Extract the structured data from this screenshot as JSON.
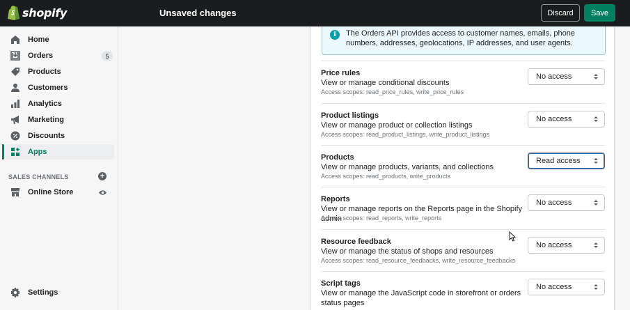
{
  "topbar": {
    "logo_text": "shopify",
    "title": "Unsaved changes",
    "discard_label": "Discard",
    "save_label": "Save"
  },
  "sidebar": {
    "items": [
      {
        "label": "Home",
        "icon": "home-icon"
      },
      {
        "label": "Orders",
        "icon": "orders-icon",
        "badge": "5"
      },
      {
        "label": "Products",
        "icon": "tag-icon"
      },
      {
        "label": "Customers",
        "icon": "person-icon"
      },
      {
        "label": "Analytics",
        "icon": "bar-chart-icon"
      },
      {
        "label": "Marketing",
        "icon": "megaphone-icon"
      },
      {
        "label": "Discounts",
        "icon": "discount-icon"
      },
      {
        "label": "Apps",
        "icon": "apps-icon",
        "active": true
      }
    ],
    "sales_channels_heading": "SALES CHANNELS",
    "online_store_label": "Online Store",
    "settings_label": "Settings"
  },
  "banner": {
    "text": "The Orders API provides access to customer names, emails, phone numbers, addresses, geolocations, IP addresses, and user agents."
  },
  "permissions": [
    {
      "title": "Price rules",
      "description": "View or manage conditional discounts",
      "scopes": "Access scopes: read_price_rules, write_price_rules",
      "value": "No access"
    },
    {
      "title": "Product listings",
      "description": "View or manage product or collection listings",
      "scopes": "Access scopes: read_product_listings, write_product_listings",
      "value": "No access"
    },
    {
      "title": "Products",
      "description": "View or manage products, variants, and collections",
      "scopes": "Access scopes: read_products, write_products",
      "value": "Read access"
    },
    {
      "title": "Reports",
      "description": "View or manage reports on the Reports page in the Shopify admin",
      "scopes": "Access scopes: read_reports, write_reports",
      "value": "No access"
    },
    {
      "title": "Resource feedback",
      "description": "View or manage the status of shops and resources",
      "scopes": "Access scopes: read_resource_feedbacks, write_resource_feedbacks",
      "value": "No access"
    },
    {
      "title": "Script tags",
      "description": "View or manage the JavaScript code in storefront or orders status pages",
      "scopes": "",
      "value": "No access"
    }
  ],
  "colors": {
    "topbar_bg": "#1a1c1d",
    "save_button": "#008060",
    "active_nav": "#008060",
    "banner_bg": "#ebf9fc",
    "info_icon": "#00a0ac",
    "focus_ring": "#2c6ecb"
  }
}
